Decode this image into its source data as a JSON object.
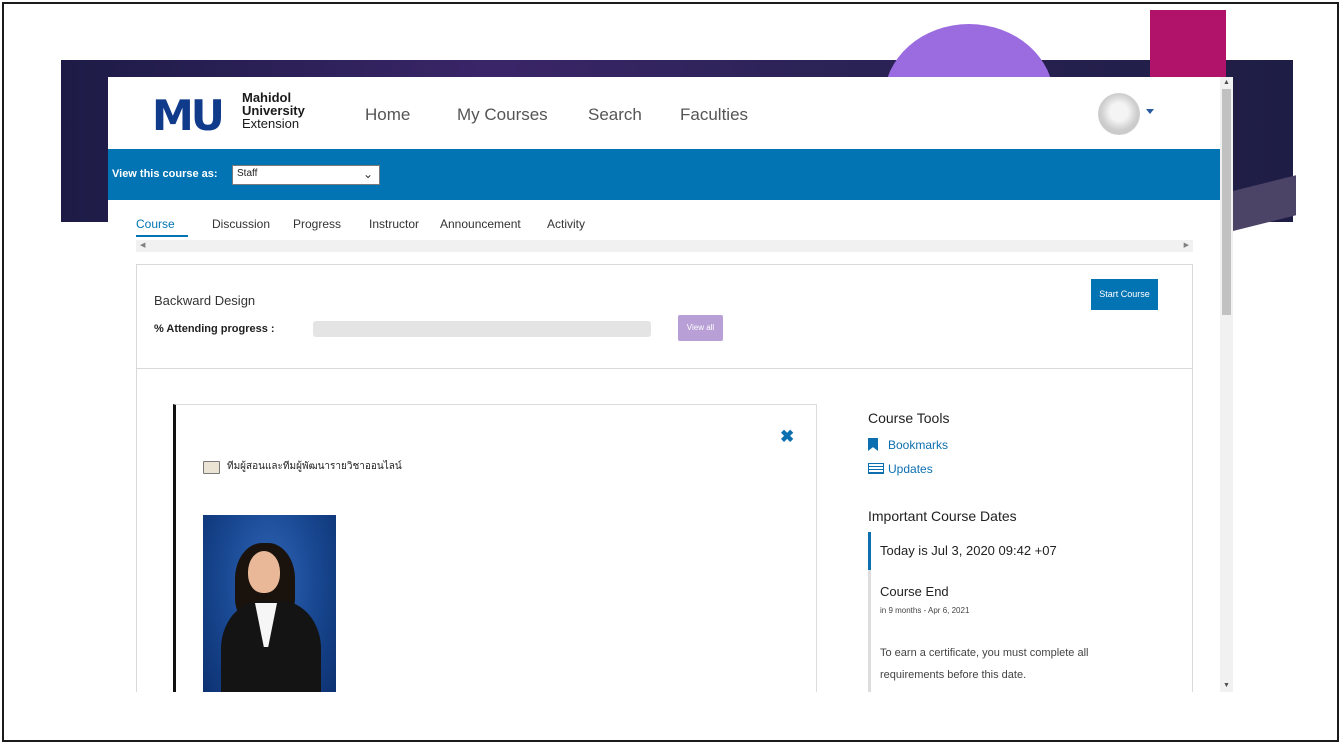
{
  "logo": {
    "mark": "MU",
    "line1": "Mahidol",
    "line2": "University",
    "line3": "Extension"
  },
  "nav": {
    "items": [
      "Home",
      "My Courses",
      "Search",
      "Faculties"
    ]
  },
  "view_as": {
    "label": "View this course as:",
    "selected": "Staff"
  },
  "tabs": [
    "Course",
    "Discussion",
    "Progress",
    "Instructor",
    "Announcement",
    "Activity"
  ],
  "active_tab": "Course",
  "course": {
    "title": "Backward Design",
    "progress_label": "% Attending progress :",
    "progress": 0,
    "view_all_label": "View all",
    "start_label": "Start Course"
  },
  "content": {
    "title": "ทีมผู้สอนและทีมผู้พัฒนารายวิชาออนไลน์",
    "close_label": "✖"
  },
  "tools": {
    "heading": "Course Tools",
    "bookmarks": "Bookmarks",
    "updates": "Updates"
  },
  "dates": {
    "heading": "Important Course Dates",
    "today": "Today is Jul 3, 2020 09:42 +07",
    "end_title": "Course End",
    "end_sub": "in 9 months - Apr 6, 2021",
    "end_desc": "To earn a certificate, you must complete all requirements before this date."
  },
  "colors": {
    "primary": "#0274b3",
    "deco_band": "#2c2357",
    "deco_purple": "#9b6be0",
    "deco_magenta": "#b1136a",
    "view_all_bg": "#b89fd6"
  },
  "icons": [
    "close-icon",
    "tv-icon",
    "bookmark-icon",
    "updates-icon",
    "chevron-down-icon",
    "caret-down-icon"
  ]
}
